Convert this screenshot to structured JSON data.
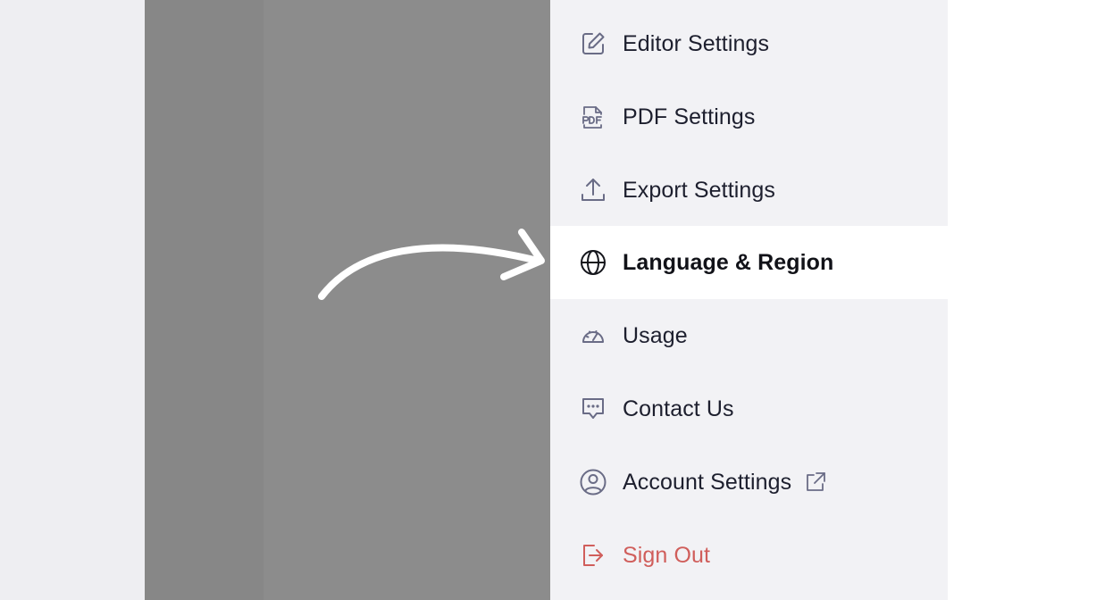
{
  "colors": {
    "menu_background": "#f2f2f5",
    "active_item_background": "#ffffff",
    "icon_color": "#6a6c86",
    "text_color": "#1d1f2e",
    "danger_color": "#d05e5b",
    "overlay_gray": "#8c8c8c"
  },
  "menu": {
    "items": [
      {
        "label": "Editor Settings",
        "icon": "edit-icon",
        "active": false
      },
      {
        "label": "PDF Settings",
        "icon": "pdf-file-icon",
        "active": false
      },
      {
        "label": "Export Settings",
        "icon": "upload-icon",
        "active": false
      },
      {
        "label": "Language & Region",
        "icon": "globe-icon",
        "active": true
      },
      {
        "label": "Usage",
        "icon": "gauge-icon",
        "active": false
      },
      {
        "label": "Contact Us",
        "icon": "chat-icon",
        "active": false
      },
      {
        "label": "Account Settings",
        "icon": "user-circle-icon",
        "active": false,
        "external": true
      },
      {
        "label": "Sign Out",
        "icon": "sign-out-icon",
        "active": false,
        "danger": true
      }
    ]
  }
}
